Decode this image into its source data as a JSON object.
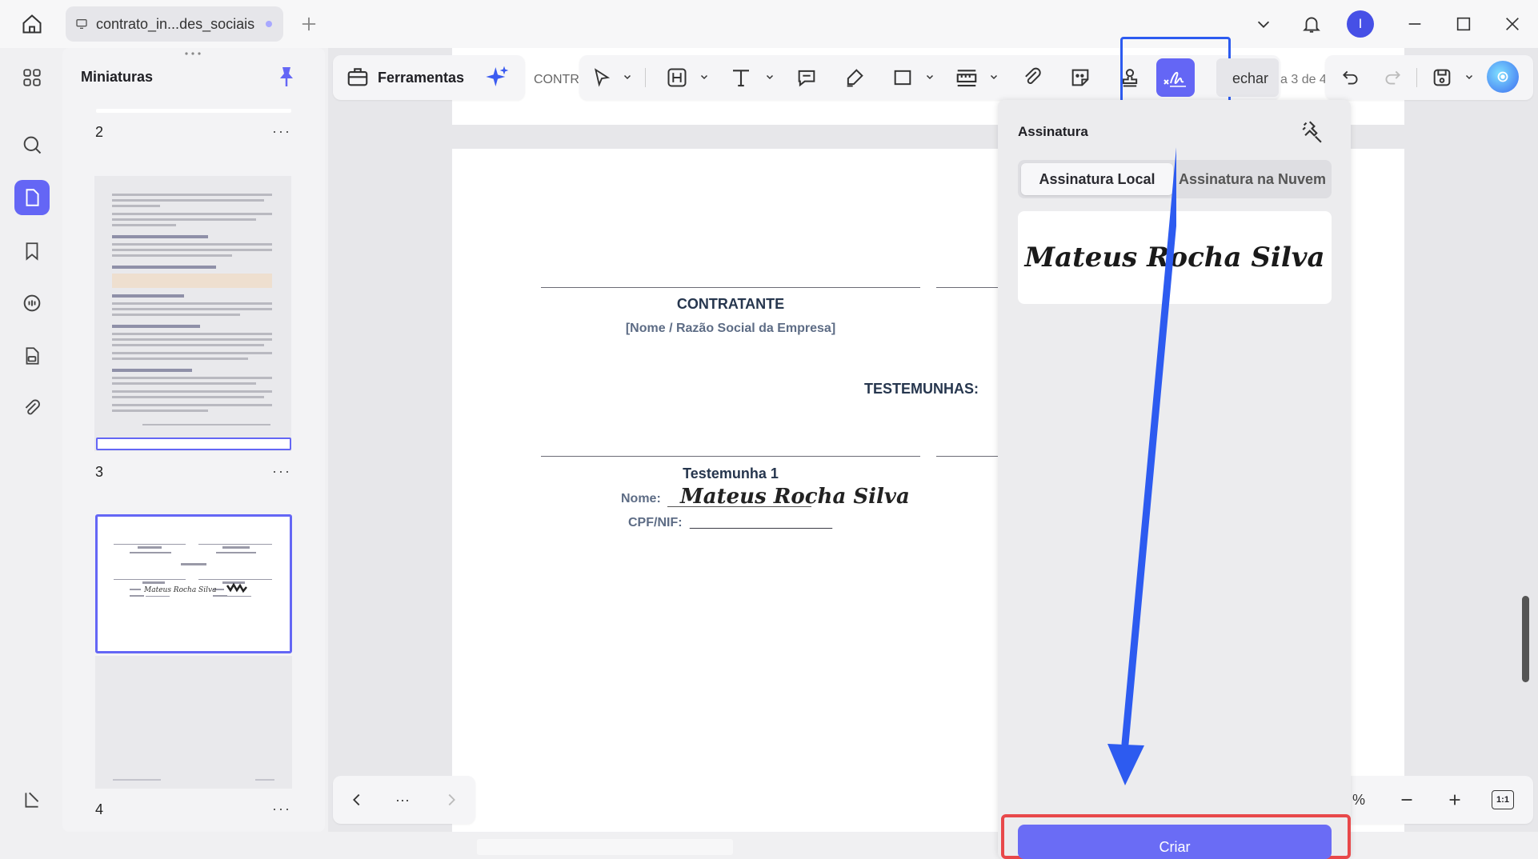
{
  "tab": {
    "title": "contrato_in...des_sociais"
  },
  "user": {
    "initial": "I"
  },
  "sidebar": {
    "title": "Miniaturas"
  },
  "thumbnails": [
    {
      "label": "2"
    },
    {
      "label": "3"
    },
    {
      "label": "4"
    }
  ],
  "toolbar": {
    "tools_label": "Ferramentas",
    "doc_name_partial": "CONTR",
    "close_partial": "echar",
    "page_counter_partial": "a 3 de 4"
  },
  "document": {
    "contratante_title": "CONTRATANTE",
    "contratante_sub": "[Nome / Razão Social da Empresa]",
    "testemunhas": "TESTEMUNHAS:",
    "witness1_title": "Testemunha 1",
    "nome_label": "Nome:",
    "cpf_label": "CPF/NIF:",
    "cpf_blank": "____________________",
    "signature_text": "Mateus Rocha Silva"
  },
  "signature_panel": {
    "title": "Assinatura",
    "tab_local": "Assinatura Local",
    "tab_cloud": "Assinatura na Nuvem",
    "saved_signature": "Mateus Rocha Silva",
    "create_button": "Criar"
  },
  "zoom": {
    "percent_partial": "%",
    "fit_label": "1:1"
  },
  "nav": {
    "more": "···"
  },
  "colors": {
    "accent": "#6466f5",
    "highlight_blue": "#2d5bf0",
    "highlight_red": "#e8484a"
  }
}
